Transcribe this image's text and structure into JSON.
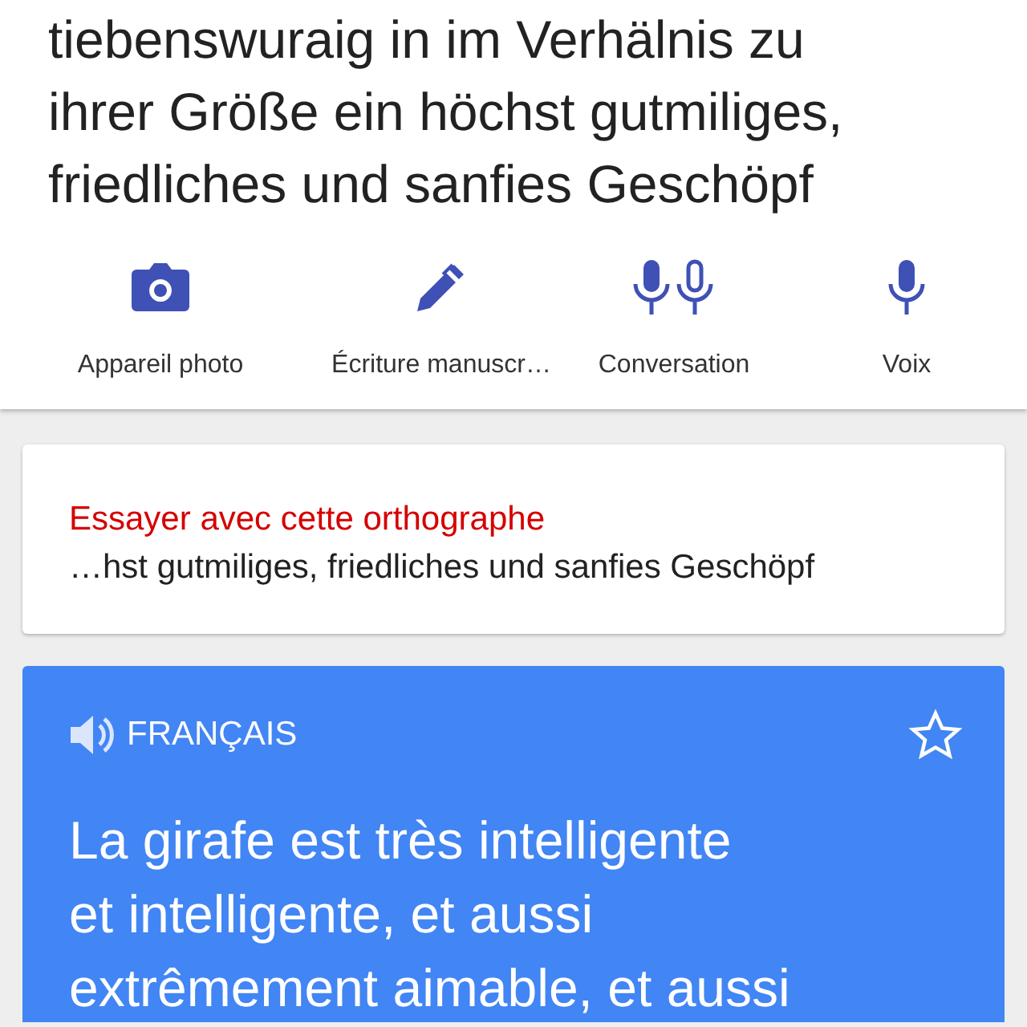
{
  "source_text": [
    "tiebenswuraig in im Verhälnis zu",
    "ihrer Größe ein höchst gutmiliges,",
    "friedliches und sanfies Geschöpf"
  ],
  "input_modes": [
    {
      "kind": "camera",
      "label": "Appareil photo"
    },
    {
      "kind": "handwriting",
      "label": "Écriture manuscr…"
    },
    {
      "kind": "conversation",
      "label": "Conversation"
    },
    {
      "kind": "voice",
      "label": "Voix"
    }
  ],
  "suggestion": {
    "title": "Essayer avec cette orthographe",
    "text": "…hst gutmiliges, friedliches und sanfies Geschöpf"
  },
  "translation": {
    "language": "FRANÇAIS",
    "starred": false,
    "lines": [
      "La girafe est très intelligente",
      "et intelligente, et aussi",
      "extrêmement aimable, et aussi"
    ]
  }
}
